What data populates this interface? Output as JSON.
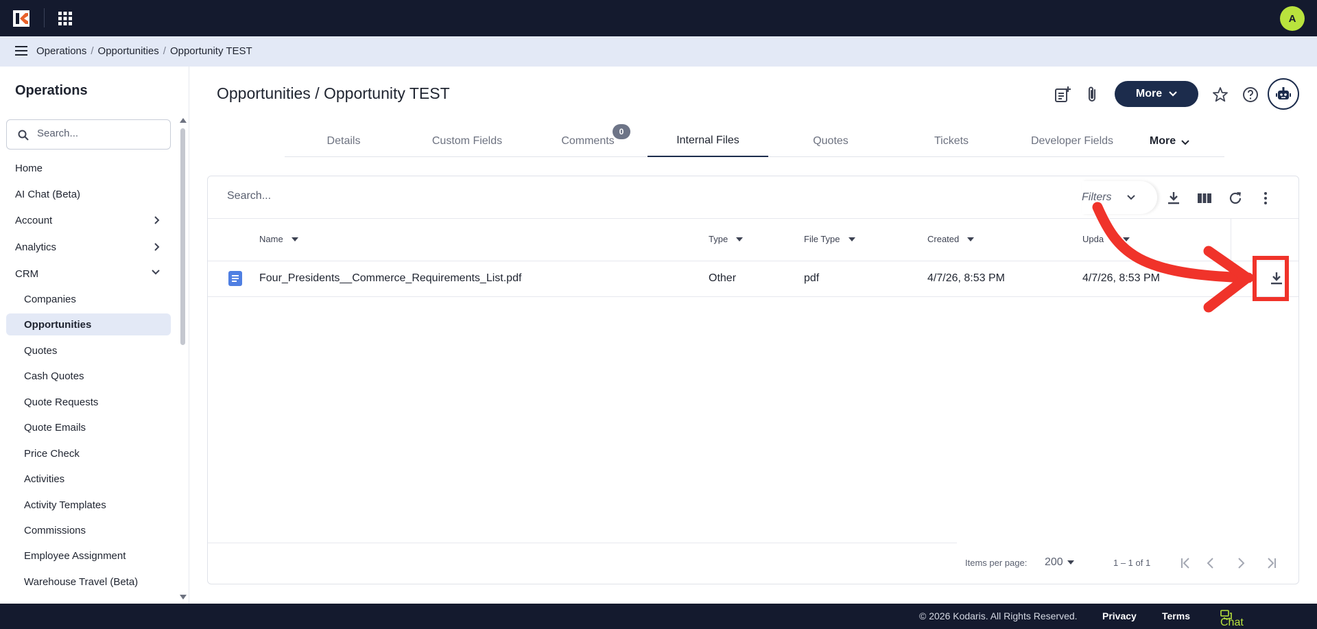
{
  "topbar": {
    "user_initial": "A"
  },
  "breadcrumb": {
    "items": [
      "Operations",
      "Opportunities",
      "Opportunity TEST"
    ],
    "separator": "/"
  },
  "sidebar": {
    "title": "Operations",
    "search_placeholder": "Search...",
    "items": [
      {
        "label": "Home"
      },
      {
        "label": "AI Chat (Beta)"
      },
      {
        "label": "Account",
        "chevron": "right"
      },
      {
        "label": "Analytics",
        "chevron": "right"
      },
      {
        "label": "CRM",
        "chevron": "down"
      },
      {
        "label": "Companies"
      },
      {
        "label": "Opportunities",
        "active": true
      },
      {
        "label": "Quotes"
      },
      {
        "label": "Cash Quotes"
      },
      {
        "label": "Quote Requests"
      },
      {
        "label": "Quote Emails"
      },
      {
        "label": "Price Check"
      },
      {
        "label": "Activities"
      },
      {
        "label": "Activity Templates"
      },
      {
        "label": "Commissions"
      },
      {
        "label": "Employee Assignment"
      },
      {
        "label": "Warehouse Travel (Beta)"
      }
    ]
  },
  "header": {
    "title": "Opportunities / Opportunity TEST",
    "more_label": "More"
  },
  "tabs": {
    "items": [
      "Details",
      "Custom Fields",
      "Comments",
      "Internal Files",
      "Quotes",
      "Tickets",
      "Developer Fields",
      "More"
    ],
    "active": "Internal Files",
    "comments_badge": "0"
  },
  "files": {
    "search_placeholder": "Search...",
    "filters_label": "Filters",
    "columns": [
      "Name",
      "Type",
      "File Type",
      "Created",
      "Updated"
    ],
    "columns_visible": [
      "Name",
      "Type",
      "File Type",
      "Created",
      "Upda"
    ],
    "rows": [
      {
        "name": "Four_Presidents__Commerce_Requirements_List.pdf",
        "type": "Other",
        "file_type": "pdf",
        "created": "4/7/26, 8:53 PM",
        "updated": "4/7/26, 8:53 PM"
      }
    ],
    "pagination": {
      "items_per_page_label": "Items per page:",
      "items_per_page": "200",
      "range": "1 – 1 of 1"
    }
  },
  "footer": {
    "copyright": "© 2026 Kodaris. All Rights Reserved.",
    "privacy": "Privacy",
    "terms": "Terms",
    "chat": "Chat with us"
  },
  "colors": {
    "navy": "#141a2e",
    "accent_green": "#b9e33d",
    "button_navy": "#1c2c4c",
    "annotation_red": "#f0332a"
  }
}
